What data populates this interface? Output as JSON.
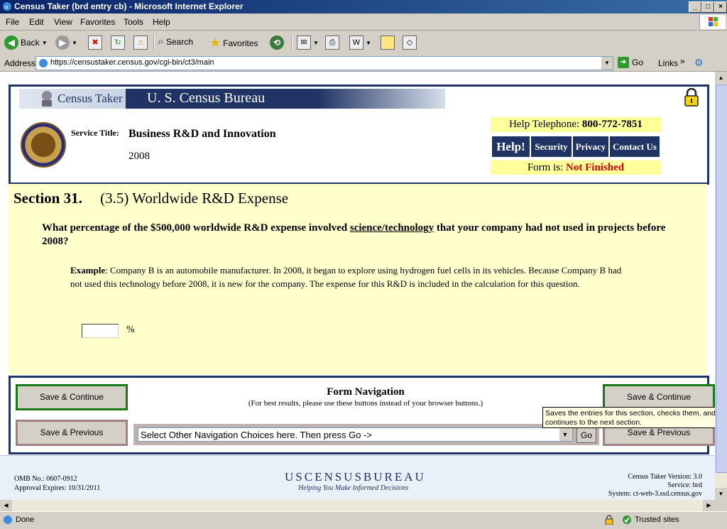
{
  "window": {
    "title": "Census Taker (brd entry cb) - Microsoft Internet Explorer"
  },
  "menu": [
    "File",
    "Edit",
    "View",
    "Favorites",
    "Tools",
    "Help"
  ],
  "toolbar": {
    "back": "Back",
    "search": "Search",
    "favorites": "Favorites"
  },
  "address": {
    "label": "Address",
    "url": "https://censustaker.census.gov/cgi-bin/ct3/main",
    "go": "Go",
    "links": "Links"
  },
  "header": {
    "brand_left": "Census Taker",
    "brand_right": "U. S. Census Bureau",
    "service_label": "Service Title:",
    "service_title": "Business R&D and Innovation",
    "year": "2008",
    "help_tel_label": "Help Telephone:",
    "help_tel_number": "800-772-7851",
    "nav": [
      "Help!",
      "Security",
      "Privacy",
      "Contact Us"
    ],
    "form_label": "Form is:",
    "form_status": "Not Finished",
    "status_color": "#d40000"
  },
  "section": {
    "number": "Section 31.",
    "title": "(3.5) Worldwide R&D Expense",
    "question_a": "What percentage of the $500,000 worldwide R&D expense involved ",
    "question_link": "science/technology",
    "question_b": " that your company had not used in projects before 2008?",
    "example_label": "Example",
    "example_text": ": Company B is an automobile manufacturer. In 2008, it began to explore using hydrogen fuel cells in its vehicles. Because Company B had not used this technology before 2008, it is new for the company. The expense for this R&D is included in the calculation for this question.",
    "percent_value": "",
    "percent_sign": "%"
  },
  "navigation": {
    "title": "Form Navigation",
    "note": "(For best results, please use these buttons instead of your browser buttons.)",
    "save_continue": "Save & Continue",
    "save_previous": "Save & Previous",
    "select_text": "Select Other Navigation Choices here. Then press Go ->",
    "go": "Go",
    "tooltip": "Saves the entries for this section, checks them, and continues to the next section."
  },
  "footer": {
    "omb": "OMB No.: 0607-0912",
    "approval": "Approval Expires: 10/31/2011",
    "logo": "USCENSUSBUREAU",
    "tagline": "Helping You Make Informed Decisions",
    "version": "Census Taker Version: 3.0",
    "service": "Service: brd",
    "system": "System: ct-web-3.ssd.census.gov"
  },
  "status": {
    "left": "Done",
    "zone": "Trusted sites"
  }
}
